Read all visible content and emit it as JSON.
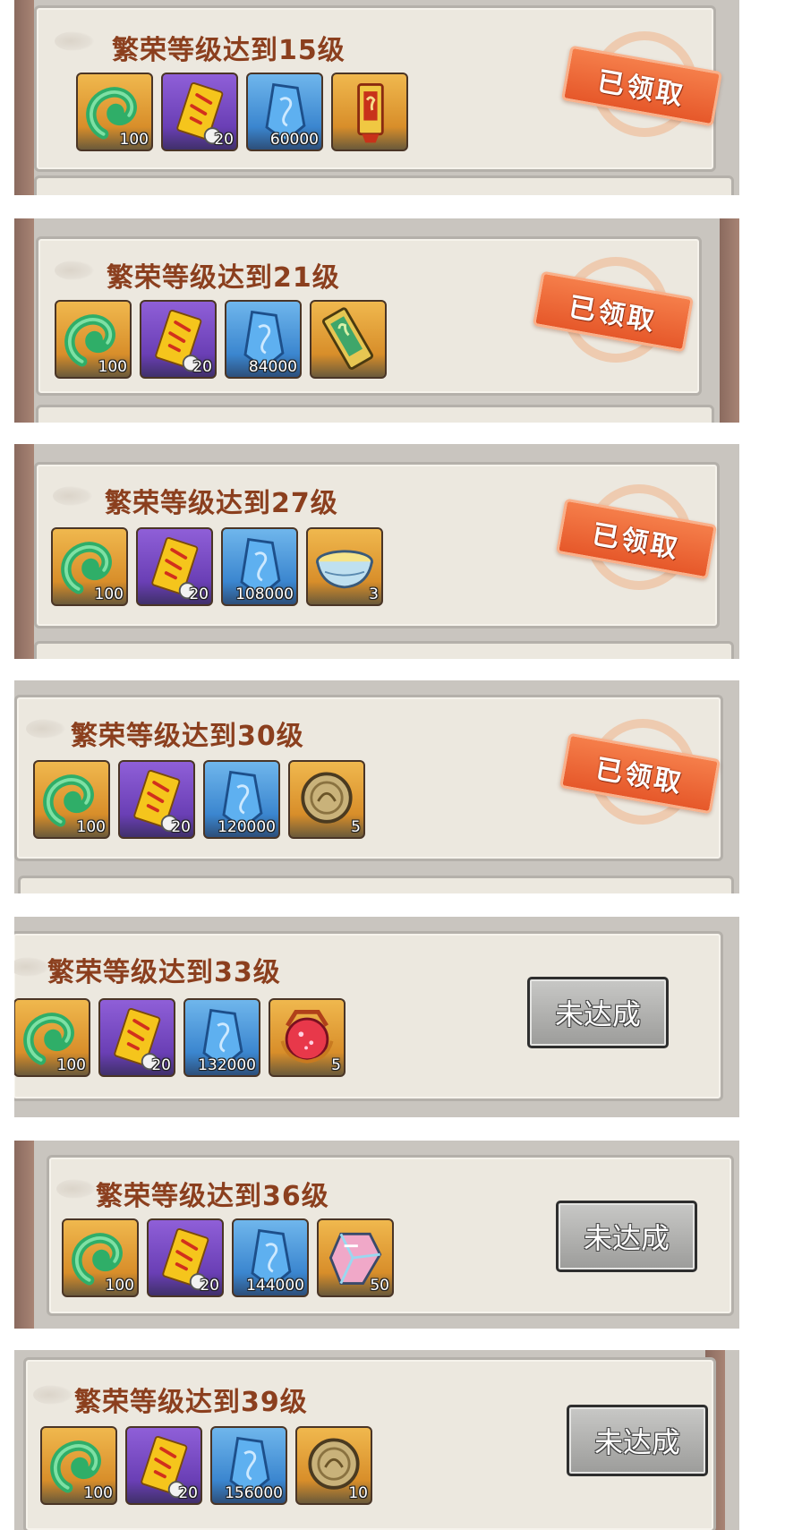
{
  "stamp_label": "已领取",
  "button_label": "未达成",
  "colors": {
    "title": "#8b3f1e",
    "stamp": "#e6582a",
    "button": "#9c9c9a"
  },
  "rewards": [
    {
      "title": "繁荣等级达到15级",
      "status": "claimed",
      "items": [
        {
          "icon": "jade-icon",
          "qty": "100"
        },
        {
          "icon": "scroll-icon",
          "qty": "20"
        },
        {
          "icon": "crystal-icon",
          "qty": "60000"
        },
        {
          "icon": "token-icon",
          "qty": ""
        }
      ]
    },
    {
      "title": "繁荣等级达到21级",
      "status": "claimed",
      "items": [
        {
          "icon": "jade-icon",
          "qty": "100"
        },
        {
          "icon": "scroll-icon",
          "qty": "20"
        },
        {
          "icon": "crystal-icon",
          "qty": "84000"
        },
        {
          "icon": "talisman-icon",
          "qty": ""
        }
      ]
    },
    {
      "title": "繁荣等级达到27级",
      "status": "claimed",
      "items": [
        {
          "icon": "jade-icon",
          "qty": "100"
        },
        {
          "icon": "scroll-icon",
          "qty": "20"
        },
        {
          "icon": "crystal-icon",
          "qty": "108000"
        },
        {
          "icon": "bowl-icon",
          "qty": "3"
        }
      ]
    },
    {
      "title": "繁荣等级达到30级",
      "status": "claimed",
      "items": [
        {
          "icon": "jade-icon",
          "qty": "100"
        },
        {
          "icon": "scroll-icon",
          "qty": "20"
        },
        {
          "icon": "crystal-icon",
          "qty": "120000"
        },
        {
          "icon": "coin-icon",
          "qty": "5"
        }
      ]
    },
    {
      "title": "繁荣等级达到33级",
      "status": "locked",
      "items": [
        {
          "icon": "jade-icon",
          "qty": "100"
        },
        {
          "icon": "scroll-icon",
          "qty": "20"
        },
        {
          "icon": "crystal-icon",
          "qty": "132000"
        },
        {
          "icon": "orb-icon",
          "qty": "5"
        }
      ]
    },
    {
      "title": "繁荣等级达到36级",
      "status": "locked",
      "items": [
        {
          "icon": "jade-icon",
          "qty": "100"
        },
        {
          "icon": "scroll-icon",
          "qty": "20"
        },
        {
          "icon": "crystal-icon",
          "qty": "144000"
        },
        {
          "icon": "gem-icon",
          "qty": "50"
        }
      ]
    },
    {
      "title": "繁荣等级达到39级",
      "status": "locked",
      "items": [
        {
          "icon": "jade-icon",
          "qty": "100"
        },
        {
          "icon": "scroll-icon",
          "qty": "20"
        },
        {
          "icon": "crystal-icon",
          "qty": "156000"
        },
        {
          "icon": "coin-icon",
          "qty": "10"
        }
      ]
    }
  ]
}
